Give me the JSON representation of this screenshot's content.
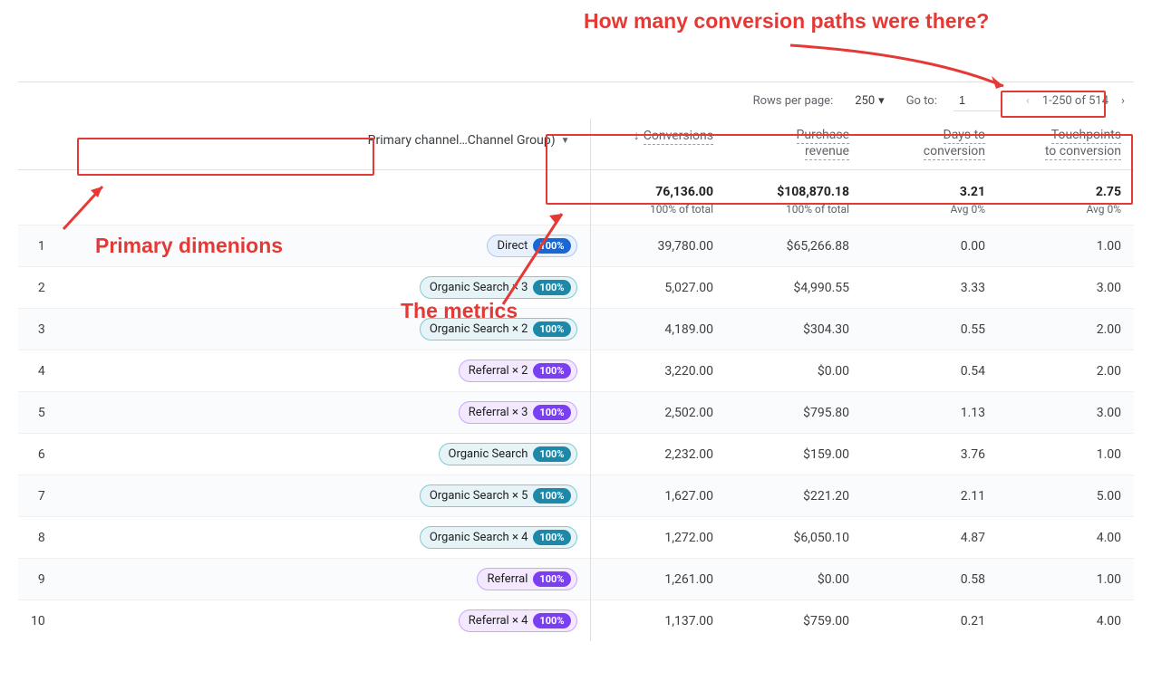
{
  "annotations": {
    "top": "How many conversion paths were there?",
    "primary": "Primary dimenions",
    "metrics": "The metrics"
  },
  "controls": {
    "rows_label": "Rows per page:",
    "rows_value": "250",
    "goto_label": "Go to:",
    "goto_value": "1",
    "page_range": "1-250 of 514"
  },
  "header": {
    "dimension_label": "Primary channel…Channel Group)",
    "metrics": [
      {
        "line1": "Conversions",
        "line2": "",
        "sorted": true
      },
      {
        "line1": "Purchase",
        "line2": "revenue",
        "sorted": false
      },
      {
        "line1": "Days to",
        "line2": "conversion",
        "sorted": false
      },
      {
        "line1": "Touchpoints",
        "line2": "to conversion",
        "sorted": false
      }
    ]
  },
  "totals": {
    "conversions": {
      "val": "76,136.00",
      "sub": "100% of total"
    },
    "revenue": {
      "val": "$108,870.18",
      "sub": "100% of total"
    },
    "days": {
      "val": "3.21",
      "sub": "Avg 0%"
    },
    "touchpoints": {
      "val": "2.75",
      "sub": "Avg 0%"
    }
  },
  "rows": [
    {
      "idx": "1",
      "channel": "Direct",
      "mult": "",
      "pct": "100%",
      "style": "blue",
      "conversions": "39,780.00",
      "revenue": "$65,266.88",
      "days": "0.00",
      "tp": "1.00"
    },
    {
      "idx": "2",
      "channel": "Organic Search",
      "mult": "× 3",
      "pct": "100%",
      "style": "teal",
      "conversions": "5,027.00",
      "revenue": "$4,990.55",
      "days": "3.33",
      "tp": "3.00"
    },
    {
      "idx": "3",
      "channel": "Organic Search",
      "mult": "× 2",
      "pct": "100%",
      "style": "teal",
      "conversions": "4,189.00",
      "revenue": "$304.30",
      "days": "0.55",
      "tp": "2.00"
    },
    {
      "idx": "4",
      "channel": "Referral",
      "mult": "× 2",
      "pct": "100%",
      "style": "purple",
      "conversions": "3,220.00",
      "revenue": "$0.00",
      "days": "0.54",
      "tp": "2.00"
    },
    {
      "idx": "5",
      "channel": "Referral",
      "mult": "× 3",
      "pct": "100%",
      "style": "purple",
      "conversions": "2,502.00",
      "revenue": "$795.80",
      "days": "1.13",
      "tp": "3.00"
    },
    {
      "idx": "6",
      "channel": "Organic Search",
      "mult": "",
      "pct": "100%",
      "style": "teal",
      "conversions": "2,232.00",
      "revenue": "$159.00",
      "days": "3.76",
      "tp": "1.00"
    },
    {
      "idx": "7",
      "channel": "Organic Search",
      "mult": "× 5",
      "pct": "100%",
      "style": "teal",
      "conversions": "1,627.00",
      "revenue": "$221.20",
      "days": "2.11",
      "tp": "5.00"
    },
    {
      "idx": "8",
      "channel": "Organic Search",
      "mult": "× 4",
      "pct": "100%",
      "style": "teal",
      "conversions": "1,272.00",
      "revenue": "$6,050.10",
      "days": "4.87",
      "tp": "4.00"
    },
    {
      "idx": "9",
      "channel": "Referral",
      "mult": "",
      "pct": "100%",
      "style": "purple",
      "conversions": "1,261.00",
      "revenue": "$0.00",
      "days": "0.58",
      "tp": "1.00"
    },
    {
      "idx": "10",
      "channel": "Referral",
      "mult": "× 4",
      "pct": "100%",
      "style": "purple",
      "conversions": "1,137.00",
      "revenue": "$759.00",
      "days": "0.21",
      "tp": "4.00"
    }
  ]
}
